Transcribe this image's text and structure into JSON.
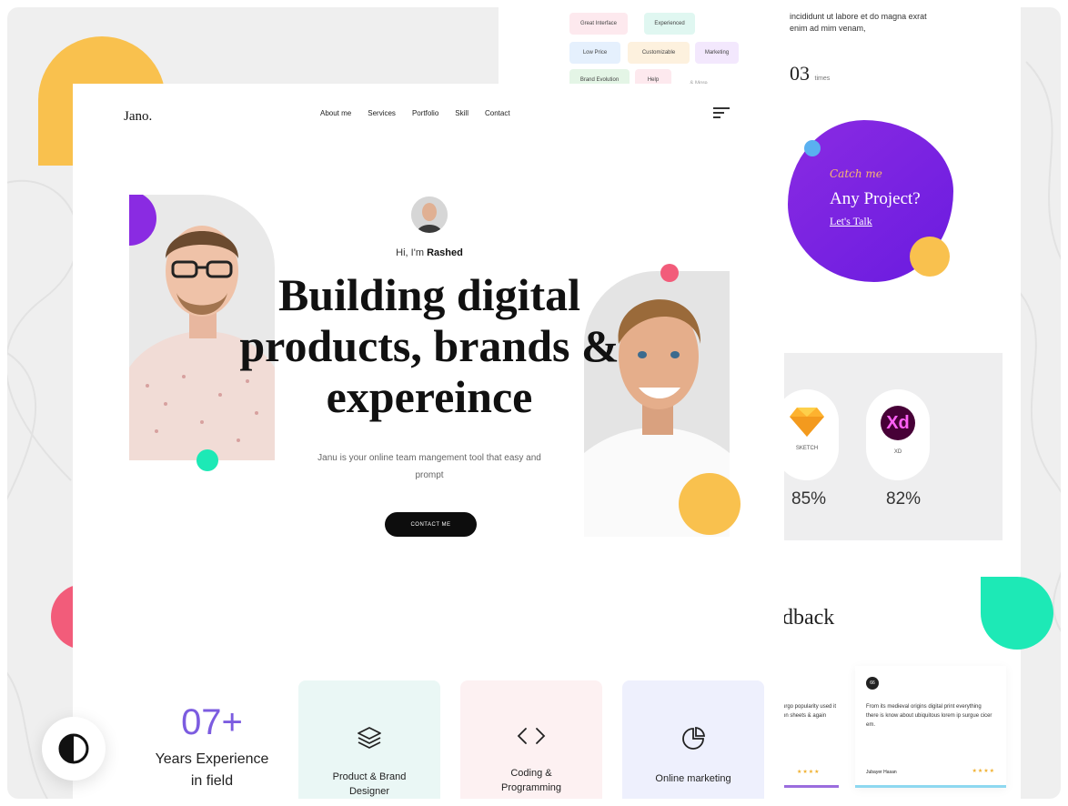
{
  "back_card": {
    "chips": [
      "Great Interface",
      "Experienced",
      "Low Price",
      "Customizable",
      "Marketing",
      "Brand Evolution",
      "Help",
      "& More"
    ]
  },
  "right_panel": {
    "intro_text_1": "incididunt ut labore et do magna exrat",
    "intro_text_2": "enim ad mim venam,",
    "times_number": "03",
    "times_unit": "times",
    "blob": {
      "script": "Catch me",
      "title": "Any Project?",
      "link": "Let's Talk"
    },
    "skills": [
      {
        "label": "SKETCH",
        "percent": "85%",
        "icon": "sketch-icon"
      },
      {
        "label": "XD",
        "percent": "82%",
        "icon": "xd-icon"
      }
    ],
    "feedback_title": "dback",
    "feedback": [
      {
        "text": "urgo popularity used it on sheets & again"
      },
      {
        "avatar": "66",
        "text": "From its medieval origins digital print everything there is know about ubiquitous lorem ip surgue cicer em.",
        "name": "Jubayer Hasan"
      }
    ]
  },
  "nav": {
    "logo": "Jano.",
    "items": [
      "About me",
      "Services",
      "Portfolio",
      "Skill",
      "Contact"
    ]
  },
  "hero": {
    "greeting_prefix": "Hi, I'm ",
    "greeting_name": "Rashed",
    "headline": "Building digital products, brands & expereince",
    "subtext": "Janu is your online team mangement tool that easy and prompt",
    "cta": "CONTACT ME"
  },
  "stats": {
    "number": "07+",
    "label": "Years Experience in field"
  },
  "services": [
    {
      "label": "Product & Brand Designer",
      "icon": "layers-icon"
    },
    {
      "label": "Coding & Programming",
      "icon": "code-icon"
    },
    {
      "label": "Online marketing",
      "icon": "pie-chart-icon"
    }
  ],
  "colors": {
    "purple": "#7c5ce0",
    "yellow": "#f9c14e",
    "pink": "#f25c7a",
    "green": "#1de9b6"
  }
}
